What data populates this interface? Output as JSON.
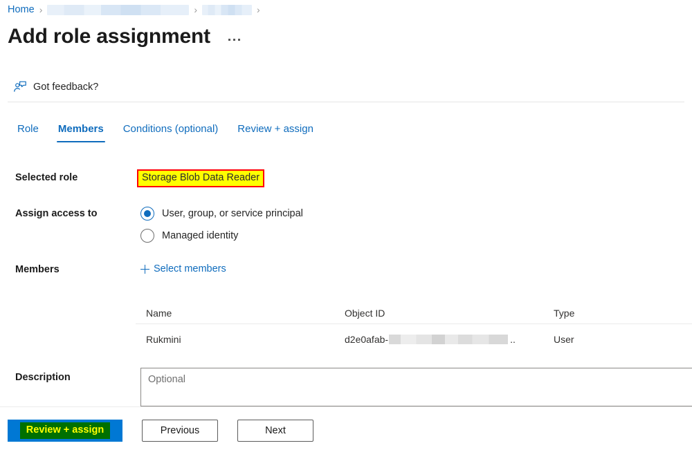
{
  "breadcrumb": {
    "home_label": "Home",
    "separator": "›",
    "items": [
      {
        "label": "",
        "redacted": true
      },
      {
        "label": "",
        "redacted": true
      }
    ]
  },
  "header": {
    "title": "Add role assignment",
    "more_actions_label": "…"
  },
  "feedback": {
    "label": "Got feedback?",
    "icon": "feedback-person-icon"
  },
  "tabs": [
    {
      "label": "Role",
      "active": false
    },
    {
      "label": "Members",
      "active": true
    },
    {
      "label": "Conditions (optional)",
      "active": false
    },
    {
      "label": "Review + assign",
      "active": false
    }
  ],
  "form": {
    "selected_role": {
      "label": "Selected role",
      "value": "Storage Blob Data Reader",
      "highlight_fill": "#ffff00",
      "highlight_border": "#ff0000"
    },
    "assign_access_to": {
      "label": "Assign access to",
      "options": [
        {
          "label": "User, group, or service principal",
          "selected": true
        },
        {
          "label": "Managed identity",
          "selected": false
        }
      ]
    },
    "members": {
      "label": "Members",
      "select_members_label": "Select members",
      "plus_icon": "plus-icon"
    },
    "description": {
      "label": "Description",
      "placeholder": "Optional",
      "value": ""
    }
  },
  "members_table": {
    "columns": [
      "Name",
      "Object ID",
      "Type"
    ],
    "rows": [
      {
        "name": "Rukmini",
        "object_id_prefix": "d2e0afab-",
        "object_id_suffix": "..",
        "object_id_redacted": true,
        "type": "User"
      }
    ]
  },
  "footer": {
    "primary": {
      "label": "Review + assign",
      "bg": "#0078d4",
      "annot_bg": "#007000",
      "annot_color": "#ffff00"
    },
    "previous_label": "Previous",
    "next_label": "Next"
  }
}
